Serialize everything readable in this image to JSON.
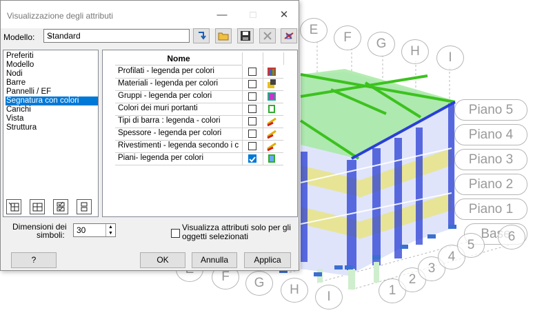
{
  "dialog": {
    "title": "Visualizzazione degli attributi",
    "model_label": "Modello:",
    "model_value": "Standard",
    "categories": [
      "Preferiti",
      "Modello",
      "Nodi",
      "Barre",
      "Pannelli / EF",
      "Segnatura con colori",
      "Carichi",
      "Vista",
      "Struttura"
    ],
    "selected_category": "Segnatura con colori",
    "grid": {
      "header": "Nome",
      "rows": [
        {
          "name": "Profilati - legenda per colori",
          "checked": false
        },
        {
          "name": "Materiali - legenda per colori",
          "checked": false
        },
        {
          "name": "Gruppi - legenda per colori",
          "checked": false
        },
        {
          "name": "Colori dei muri portanti",
          "checked": false
        },
        {
          "name": "Tipi di barra : legenda - colori",
          "checked": false
        },
        {
          "name": "Spessore - legenda per colori",
          "checked": false
        },
        {
          "name": "Rivestimenti  - legenda secondo i c...",
          "checked": false
        },
        {
          "name": "Piani- legenda per colori",
          "checked": true
        }
      ]
    },
    "symbol_size_label_1": "Dimensioni dei",
    "symbol_size_label_2": "simboli:",
    "symbol_size_value": "30",
    "selected_only_label_1": "Visualizza attributi solo per gli",
    "selected_only_label_2": "oggetti selezionati",
    "buttons": {
      "help": "?",
      "ok": "OK",
      "cancel": "Annulla",
      "apply": "Applica"
    }
  },
  "model_view": {
    "axis_letters": [
      "E",
      "F",
      "G",
      "H",
      "I"
    ],
    "axis_letters_bottom": [
      "E",
      "F",
      "G",
      "H",
      "I"
    ],
    "axis_numbers": [
      "1",
      "2",
      "3",
      "4",
      "5",
      "6"
    ],
    "levels": [
      "Piano 5",
      "Piano 4",
      "Piano 3",
      "Piano 2",
      "Piano 1",
      "Base"
    ]
  },
  "colors": {
    "selection": "#0078d7",
    "frame_green": "#3cc21e",
    "frame_blue": "#2a3fd6",
    "slab_yellow": "#e8e07a"
  }
}
